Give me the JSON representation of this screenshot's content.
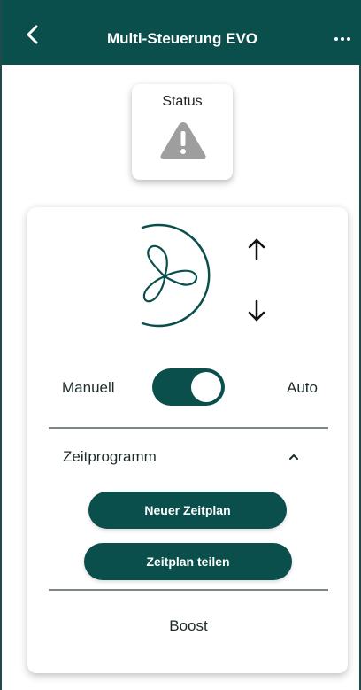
{
  "header": {
    "title": "Multi-Steuerung EVO",
    "back_icon": "chevron-left-icon",
    "more_icon": "more-horizontal-icon"
  },
  "status": {
    "label": "Status",
    "icon": "warning-triangle-icon"
  },
  "control": {
    "fan_icon": "fan-icon",
    "increase_icon": "arrow-up-icon",
    "decrease_icon": "arrow-down-icon",
    "mode_left": "Manuell",
    "mode_right": "Auto",
    "toggle_state": "Auto"
  },
  "schedule": {
    "section_label": "Zeitprogramm",
    "expanded": true,
    "new_button": "Neuer Zeitplan",
    "share_button": "Zeitplan teilen"
  },
  "boost": {
    "label": "Boost"
  },
  "colors": {
    "brand": "#0b4f4d",
    "warning_icon": "#9e9e9e"
  }
}
